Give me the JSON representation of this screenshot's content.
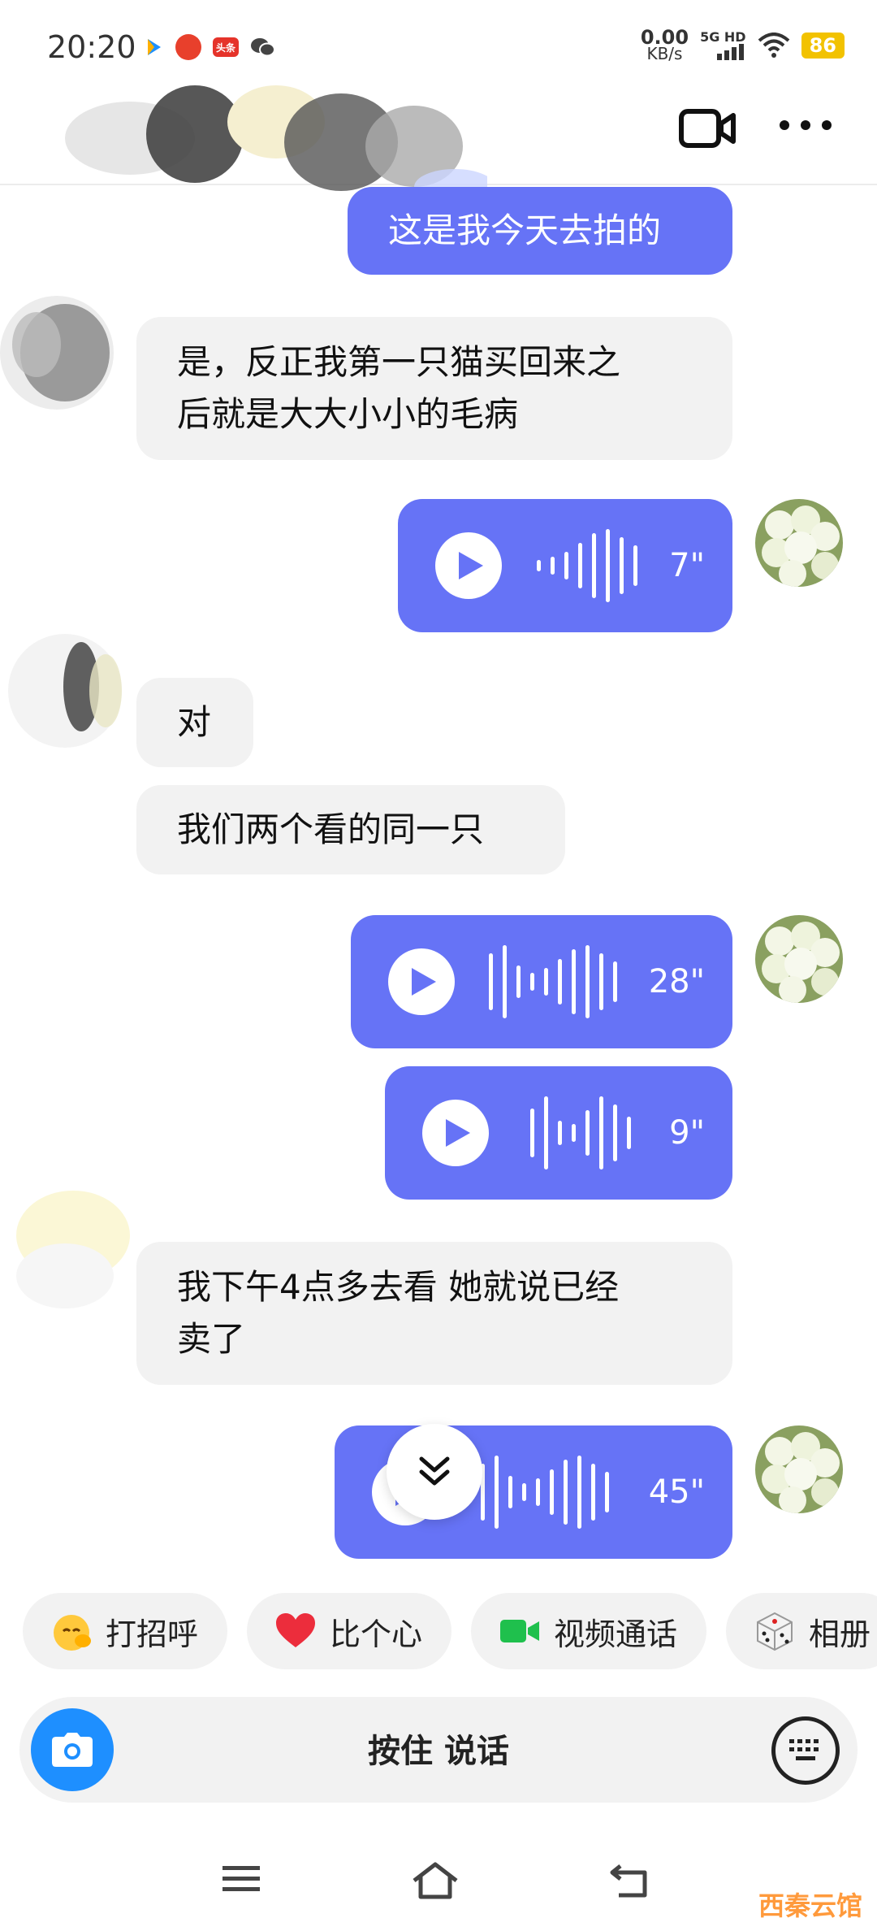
{
  "status_bar": {
    "time": "20:20",
    "net_speed_value": "0.00",
    "net_speed_unit": "KB/s",
    "signal_label": "5G HD",
    "battery": "86",
    "app_icons": [
      "video-app-icon",
      "robot-app-icon",
      "toutiao-icon",
      "wechat-icon"
    ],
    "toutiao_label": "头条"
  },
  "header": {
    "contact_name_hidden": true,
    "actions": [
      "video-call-icon",
      "more-icon"
    ]
  },
  "messages": [
    {
      "side": "me",
      "type": "text",
      "text": "这是我今天去拍的"
    },
    {
      "side": "other",
      "type": "text",
      "lines": [
        "是，反正我第一只猫买回来之",
        "后就是大大小小的毛病"
      ]
    },
    {
      "side": "me",
      "type": "voice",
      "duration": "7\""
    },
    {
      "side": "other",
      "type": "text",
      "text": "对"
    },
    {
      "side": "other",
      "type": "text",
      "text": "我们两个看的同一只"
    },
    {
      "side": "me",
      "type": "voice",
      "duration": "28\""
    },
    {
      "side": "me",
      "type": "voice",
      "duration": "9\""
    },
    {
      "side": "other",
      "type": "text",
      "lines": [
        "我下午4点多去看 她就说已经",
        "卖了"
      ]
    },
    {
      "side": "me",
      "type": "voice",
      "duration": "45\""
    }
  ],
  "quick_actions": [
    {
      "icon": "wave-hand-emoji-icon",
      "label": "打招呼"
    },
    {
      "icon": "heart-icon",
      "label": "比个心"
    },
    {
      "icon": "video-camera-icon",
      "label": "视频通话"
    },
    {
      "icon": "dice-icon",
      "label": "相册"
    }
  ],
  "input": {
    "hold_to_talk": "按住 说话"
  },
  "nav": [
    "menu-icon",
    "home-icon",
    "back-icon"
  ],
  "watermark": "西秦云馆",
  "colors": {
    "my_bubble": "#6673f6",
    "other_bubble": "#f2f2f2",
    "camera_button": "#1e8fff",
    "battery": "#f2c200"
  }
}
